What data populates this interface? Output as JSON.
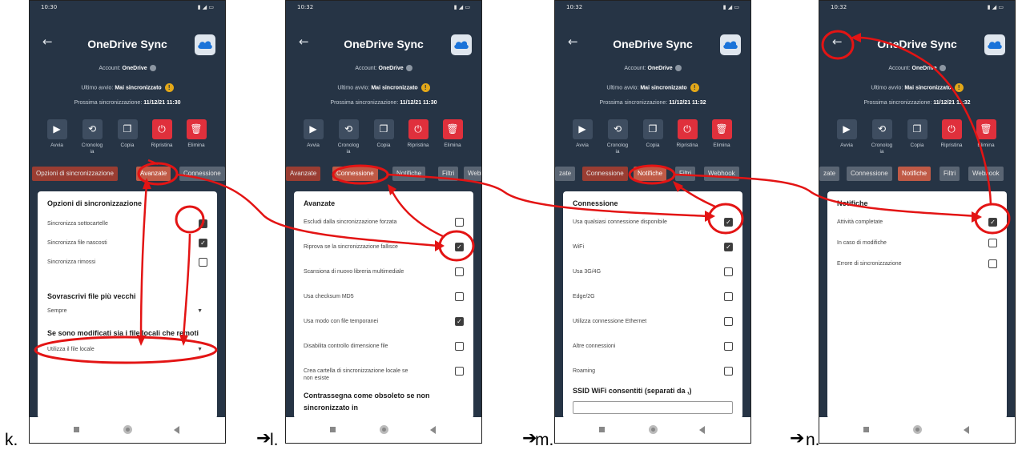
{
  "steps": {
    "k": "k.",
    "l": "l.",
    "m": "m.",
    "n": "n.",
    "arrow": "➔"
  },
  "phones": [
    {
      "time": "10:30",
      "title": "OneDrive Sync",
      "account_label": "Account:",
      "account_value": "OneDrive",
      "last_sync_label": "Ultimo avvio:",
      "last_sync_value": "Mai sincronizzato",
      "next_sync_label": "Prossima sincronizzazione:",
      "next_sync_value": "11/12/21 11:30",
      "actions": [
        "Avvia",
        "Cronolog\nia",
        "Copia",
        "Ripristina",
        "Elimina"
      ],
      "tabs": [
        "Opzioni di sincronizzazione",
        "Avanzate",
        "Connessione"
      ],
      "section": "Opzioni di sincronizzazione",
      "rows": [
        {
          "label": "Sincronizza sottocartelle",
          "checked": true
        },
        {
          "label": "Sincronizza file nascosti",
          "checked": true
        },
        {
          "label": "Sincronizza rimossi",
          "checked": false
        }
      ],
      "section2": "Sovrascrivi file più vecchi",
      "select1": "Sempre",
      "section3": "Se sono modificati sia i file locali che remoti",
      "select2": "Utilizza il file locale"
    },
    {
      "time": "10:32",
      "title": "OneDrive Sync",
      "account_label": "Account:",
      "account_value": "OneDrive",
      "last_sync_label": "Ultimo avvio:",
      "last_sync_value": "Mai sincronizzato",
      "next_sync_label": "Prossima sincronizzazione:",
      "next_sync_value": "11/12/21 11:30",
      "actions": [
        "Avvia",
        "Cronolog\nia",
        "Copia",
        "Ripristina",
        "Elimina"
      ],
      "tabs": [
        "Avanzate",
        "Connessione",
        "Notifiche",
        "Filtri",
        "Webh"
      ],
      "section": "Avanzate",
      "rows": [
        {
          "label": "Escludi dalla sincronizzazione forzata",
          "checked": false
        },
        {
          "label": "Riprova se la sincronizzazione fallisce",
          "checked": true
        },
        {
          "label": "Scansiona di nuovo libreria multimediale",
          "checked": false
        },
        {
          "label": "Usa checksum MD5",
          "checked": false
        },
        {
          "label": "Usa modo con file temporanei",
          "checked": true
        },
        {
          "label": "Disabilita controllo dimensione file",
          "checked": false
        },
        {
          "label": "Crea cartella di sincronizzazione locale se\nnon esiste",
          "checked": false
        }
      ],
      "section2": "Contrassegna come obsoleto se non\nsincronizzato in"
    },
    {
      "time": "10:32",
      "title": "OneDrive Sync",
      "account_label": "Account:",
      "account_value": "OneDrive",
      "last_sync_label": "Ultimo avvio:",
      "last_sync_value": "Mai sincronizzato",
      "next_sync_label": "Prossima sincronizzazione:",
      "next_sync_value": "11/12/21 11:32",
      "actions": [
        "Avvia",
        "Cronolog\nia",
        "Copia",
        "Ripristina",
        "Elimina"
      ],
      "tabs": [
        "zate",
        "Connessione",
        "Notifiche",
        "Filtri",
        "Webhook"
      ],
      "section": "Connessione",
      "rows": [
        {
          "label": "Usa qualsiasi connessione disponibile",
          "checked": true
        },
        {
          "label": "WiFi",
          "checked": true
        },
        {
          "label": "Usa 3G/4G",
          "checked": false
        },
        {
          "label": "Edge/2G",
          "checked": false
        },
        {
          "label": "Utilizza connessione Ethernet",
          "checked": false
        },
        {
          "label": "Altre connessioni",
          "checked": false
        },
        {
          "label": "Roaming",
          "checked": false
        }
      ],
      "section2": "SSID WiFi consentiti (separati da ,)"
    },
    {
      "time": "10:32",
      "title": "OneDrive Sync",
      "account_label": "Account:",
      "account_value": "OneDrive",
      "last_sync_label": "Ultimo avvio:",
      "last_sync_value": "Mai sincronizzato",
      "next_sync_label": "Prossima sincronizzazione:",
      "next_sync_value": "11/12/21 11:32",
      "actions": [
        "Avvia",
        "Cronolog\nia",
        "Copia",
        "Ripristina",
        "Elimina"
      ],
      "tabs": [
        "zate",
        "Connessione",
        "Notifiche",
        "Filtri",
        "Webhook"
      ],
      "section": "Notifiche",
      "rows": [
        {
          "label": "Attività completate",
          "checked": true
        },
        {
          "label": "In caso di modifiche",
          "checked": false
        },
        {
          "label": "Errore di sincronizzazione",
          "checked": false
        }
      ]
    }
  ],
  "colors": {
    "app_bg": "#263445",
    "annotation": "#e31414",
    "play": "#3e4d60",
    "danger": "#e0303c"
  }
}
